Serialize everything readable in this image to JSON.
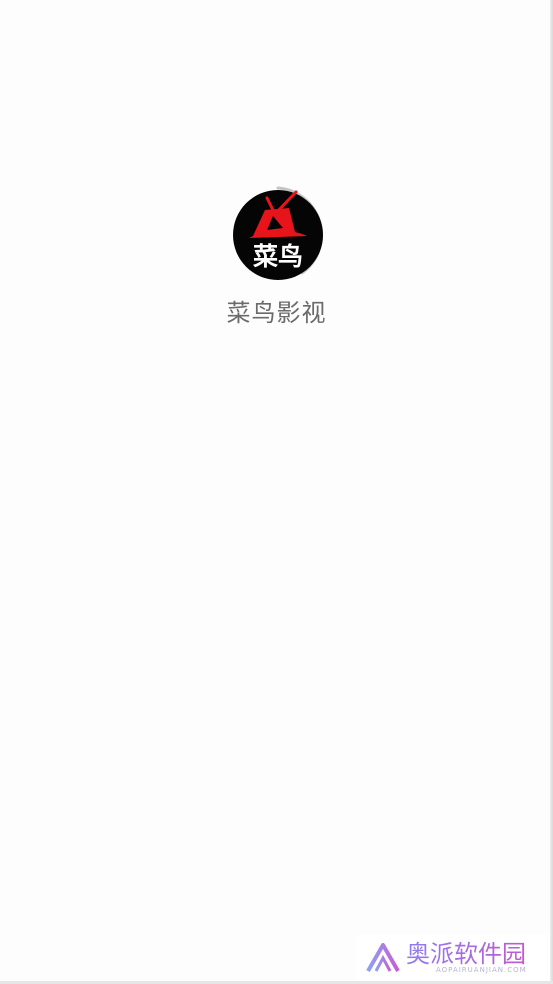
{
  "app": {
    "name": "菜鸟影视",
    "logo_text": "菜鸟"
  },
  "watermark": {
    "title": "奥派软件园",
    "subtitle": "AOPAIRUANJIAN.COM"
  },
  "colors": {
    "background": "#fdfdfd",
    "logo_bg": "#000000",
    "logo_red": "#e8141c",
    "app_name": "#6b6b6b",
    "progress_ring": "#b5b5b5"
  }
}
